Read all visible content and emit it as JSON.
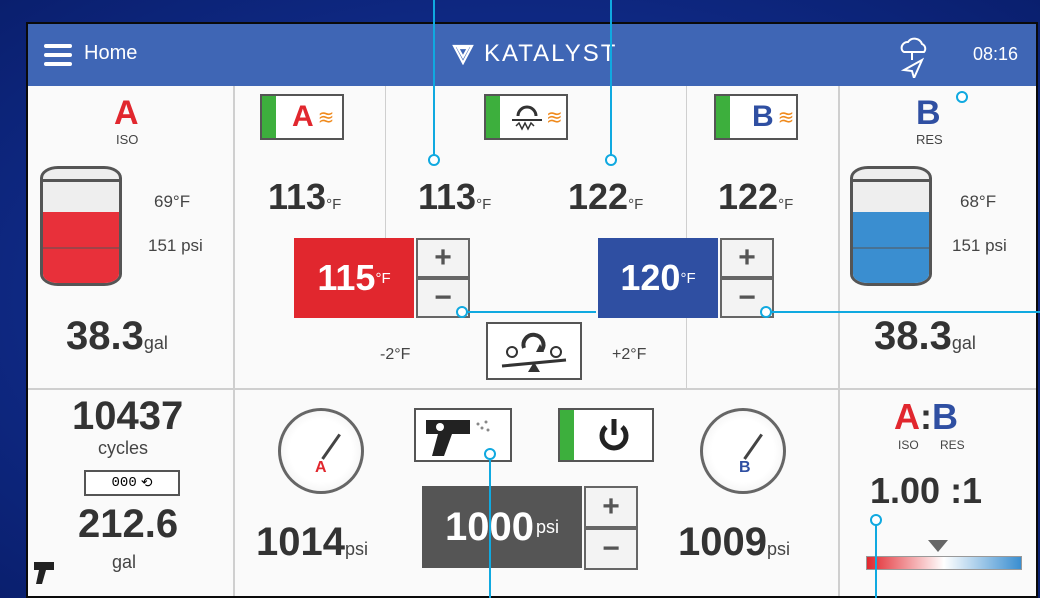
{
  "header": {
    "home_label": "Home",
    "brand": "KATALYST",
    "time": "08:16"
  },
  "tank_a": {
    "letter": "A",
    "sub": "ISO",
    "temp": "69°F",
    "pressure": "151 psi",
    "volume": "38.3",
    "volume_unit": "gal",
    "color": "#e8303a",
    "fill_level": 0.62
  },
  "tank_b": {
    "letter": "B",
    "sub": "RES",
    "temp": "68°F",
    "pressure": "151 psi",
    "volume": "38.3",
    "volume_unit": "gal",
    "color": "#3a8ed0",
    "fill_level": 0.62
  },
  "heaters": {
    "a_actual": "113",
    "hose_a_actual": "113",
    "hose_b_actual": "122",
    "b_actual": "122",
    "unit": "°F",
    "a_setpoint": "115",
    "b_setpoint": "120",
    "offset_minus": "-2°F",
    "offset_plus": "+2°F",
    "a_set_color": "#e1272e",
    "b_set_color": "#2f4fa2"
  },
  "counter": {
    "cycles": "10437",
    "cycles_label": "cycles",
    "odometer": "000",
    "gallons": "212.6",
    "gallons_label": "gal"
  },
  "pressure": {
    "a": "1014",
    "b": "1009",
    "unit": "psi",
    "setpoint": "1000",
    "gauge_a_label": "A",
    "gauge_b_label": "B"
  },
  "ratio": {
    "a": "A",
    "colon": ":",
    "b": "B",
    "a_sub": "ISO",
    "b_sub": "RES",
    "value": "1.00 :1"
  }
}
